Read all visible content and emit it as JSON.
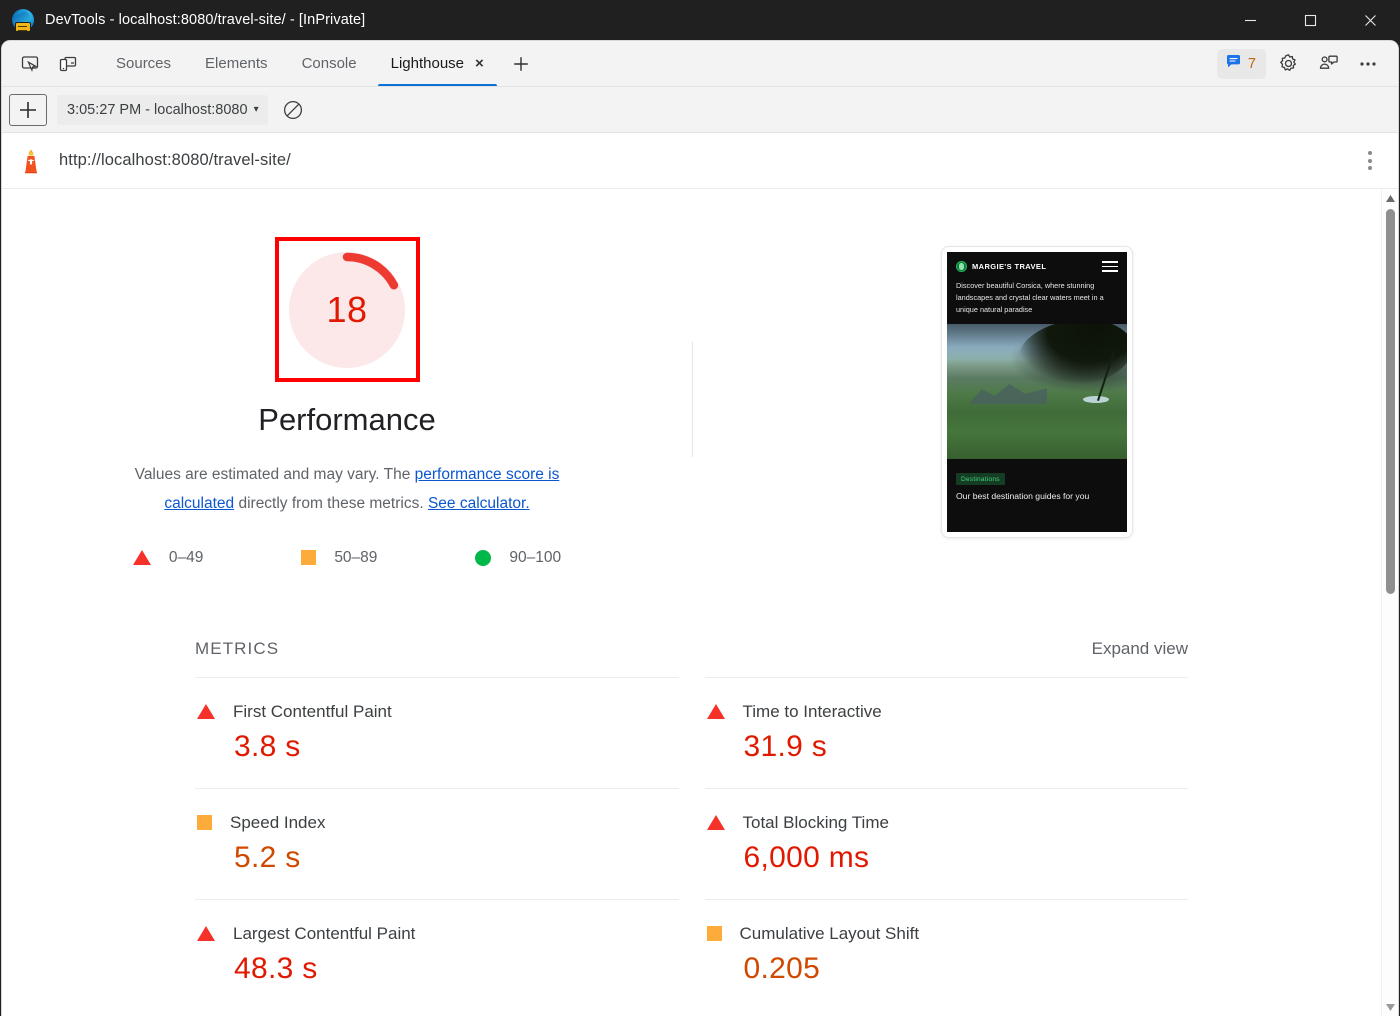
{
  "window": {
    "title": "DevTools - localhost:8080/travel-site/ - [InPrivate]",
    "app_icon": "edge-logo-icon",
    "controls": {
      "minimize": "minimize-icon",
      "maximize": "maximize-icon",
      "close": "close-icon"
    }
  },
  "devtools": {
    "left_icons": [
      {
        "name": "inspect-element-icon"
      },
      {
        "name": "device-toolbar-icon"
      }
    ],
    "tabs": [
      {
        "label": "Sources",
        "active": false
      },
      {
        "label": "Elements",
        "active": false
      },
      {
        "label": "Console",
        "active": false
      },
      {
        "label": "Lighthouse",
        "active": true,
        "closable": true
      }
    ],
    "tab_close_glyph": "×",
    "new_tab_label": "+",
    "right_icons": {
      "messages_count": "7",
      "messages_icon": "message-bubble-icon",
      "settings_icon": "gear-icon",
      "feedback_icon": "feedback-person-icon",
      "more_icon": "more-options-icon"
    }
  },
  "runbar": {
    "new_report_label": "+",
    "run_selector": "3:05:27 PM - localhost:8080",
    "caret": "▾",
    "clear_icon": "clear-all-icon"
  },
  "report": {
    "lighthouse_icon": "lighthouse-icon",
    "url": "http://localhost:8080/travel-site/",
    "more_icon": "kebab-menu-icon"
  },
  "score": {
    "value": "18",
    "value_number": 18,
    "category": "Performance",
    "gauge_color": "#e11900",
    "gauge_bg_color": "#fce8e9",
    "focus_outline_color": "#ff0000",
    "description_prefix": "Values are estimated and may vary. The ",
    "link_1": "performance score is calculated",
    "description_middle": " directly from these metrics. ",
    "link_2": "See calculator.",
    "legend": [
      {
        "icon": "triangle-fail-icon",
        "label": "0–49",
        "color": "#f5312a"
      },
      {
        "icon": "square-average-icon",
        "label": "50–89",
        "color": "#fdab3b"
      },
      {
        "icon": "circle-pass-icon",
        "label": "90–100",
        "color": "#00b84a"
      }
    ]
  },
  "thumbnail": {
    "brand": "MARGIE'S TRAVEL",
    "logo_icon": "globe-icon",
    "menu_icon": "hamburger-menu-icon",
    "lede": "Discover beautiful Corsica, where stunning landscapes and crystal clear waters meet in a unique natural paradise",
    "tag": "Destinations",
    "footer_text": "Our best destination guides for you"
  },
  "metrics": {
    "title": "METRICS",
    "expand_label": "Expand view",
    "items": [
      {
        "icon": "triangle-fail-icon",
        "status": "fail",
        "name": "First Contentful Paint",
        "value": "3.8 s",
        "value_color": "#e11900"
      },
      {
        "icon": "triangle-fail-icon",
        "status": "fail",
        "name": "Time to Interactive",
        "value": "31.9 s",
        "value_color": "#e11900"
      },
      {
        "icon": "square-average-icon",
        "status": "average",
        "name": "Speed Index",
        "value": "5.2 s",
        "value_color": "#d04900"
      },
      {
        "icon": "triangle-fail-icon",
        "status": "fail",
        "name": "Total Blocking Time",
        "value": "6,000 ms",
        "value_color": "#e11900"
      },
      {
        "icon": "triangle-fail-icon",
        "status": "fail",
        "name": "Largest Contentful Paint",
        "value": "48.3 s",
        "value_color": "#e11900"
      },
      {
        "icon": "square-average-icon",
        "status": "average",
        "name": "Cumulative Layout Shift",
        "value": "0.205",
        "value_color": "#d04900"
      }
    ]
  },
  "scrollbar": {
    "up_arrow": "scroll-up-arrow-icon",
    "down_arrow": "scroll-down-arrow-icon"
  }
}
